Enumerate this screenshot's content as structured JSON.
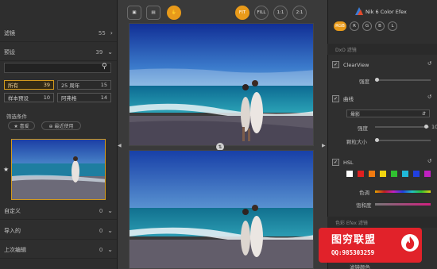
{
  "left_panel": {
    "collapsed_rows": [
      {
        "label": "滤镜",
        "count": "55"
      },
      {
        "label": "预设",
        "count": "39"
      }
    ],
    "search": {
      "placeholder": "",
      "value": ""
    },
    "filters": [
      {
        "label": "所有",
        "count": "39",
        "active": true
      },
      {
        "label": "25 周年",
        "count": "15",
        "active": false
      },
      {
        "label": "样本预设",
        "count": "10",
        "active": false
      },
      {
        "label": "阿弗格",
        "count": "14",
        "active": false
      }
    ],
    "filter_conditions_title": "筛选条件",
    "pills": [
      "★ 喜爱",
      "⊕ 最近使用"
    ],
    "bottom_rows": [
      {
        "label": "自定义",
        "count": "0"
      },
      {
        "label": "导入的",
        "count": "0"
      },
      {
        "label": "上次编辑",
        "count": "0"
      }
    ]
  },
  "toolbar": {
    "buttons": [
      "FIT",
      "FILL",
      "1:1",
      "2:1"
    ]
  },
  "right_panel": {
    "brand": "Nik 6 Color Efex",
    "channels": [
      "RGB",
      "R",
      "G",
      "B",
      "L"
    ],
    "section_title": "DxO 滤镜",
    "filters": [
      {
        "name": "ClearView",
        "checked": true,
        "params": [
          {
            "label": "强度"
          }
        ]
      },
      {
        "name": "曲线",
        "checked": true,
        "select_value": "晕影",
        "params": [
          {
            "label": "强度",
            "value": "10"
          },
          {
            "label": "颗粒大小"
          }
        ]
      },
      {
        "name": "HSL",
        "checked": true,
        "params": [
          {
            "label": "色调"
          },
          {
            "label": "饱和度"
          }
        ]
      }
    ],
    "section_title_2": "色彩 Efex 滤镜",
    "last_label": "滤镜颜色"
  },
  "watermark": {
    "title": "图穷联盟",
    "subtitle": "QQ:985303259"
  },
  "colors": {
    "accent": "#e89a1a",
    "banner": "#e1222a"
  }
}
